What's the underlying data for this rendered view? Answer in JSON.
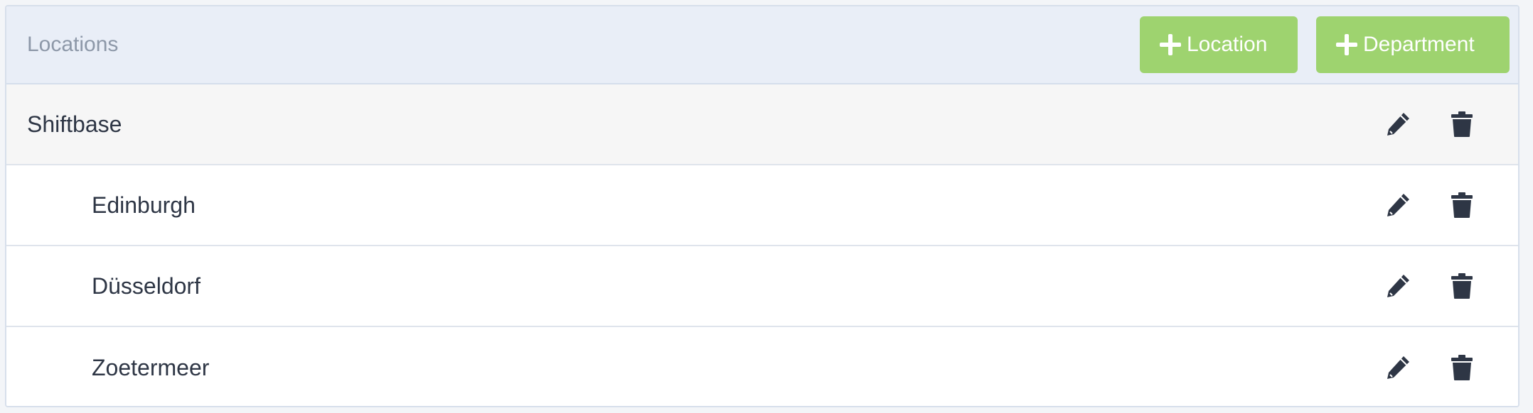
{
  "header": {
    "title": "Locations",
    "add_location_label": "Location",
    "add_department_label": "Department"
  },
  "rows": [
    {
      "label": "Shiftbase",
      "level": "parent"
    },
    {
      "label": "Edinburgh",
      "level": "child"
    },
    {
      "label": "Düsseldorf",
      "level": "child"
    },
    {
      "label": "Zoetermeer",
      "level": "child"
    }
  ],
  "icons": {
    "add": "plus-icon",
    "edit": "pencil-icon",
    "delete": "trash-icon"
  },
  "colors": {
    "accent_green": "#9ed36f",
    "header_bg": "#e9eef7",
    "icon": "#2e3645"
  }
}
